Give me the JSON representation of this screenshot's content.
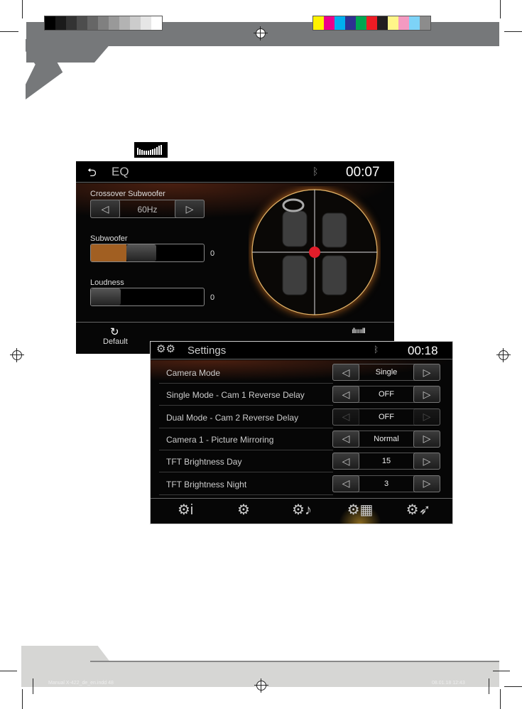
{
  "print_marks": {
    "gray_swatches": [
      "#000000",
      "#1a1a1a",
      "#333333",
      "#4d4d4d",
      "#666666",
      "#808080",
      "#999999",
      "#b3b3b3",
      "#cccccc",
      "#e6e6e6",
      "#ffffff"
    ],
    "color_swatches": [
      "#fff200",
      "#ec008c",
      "#00aeef",
      "#2e3192",
      "#00a651",
      "#ed1c24",
      "#231f20",
      "#fff689",
      "#f49ac1",
      "#7dd3f7",
      "#8c8c8c"
    ]
  },
  "eq_screen": {
    "title": "EQ",
    "time": "00:07",
    "crossover_label": "Crossover Subwoofer",
    "crossover_value": "60Hz",
    "subwoofer_label": "Subwoofer",
    "subwoofer_value": "0",
    "subwoofer_level_percent": 25,
    "loudness_label": "Loudness",
    "loudness_value": "0",
    "loudness_level_percent": 0,
    "default_label": "Default",
    "accent": "#b8651d",
    "balance_dot_color": "#e11d2a"
  },
  "settings_screen": {
    "title": "Settings",
    "time": "00:18",
    "rows": [
      {
        "label": "Camera Mode",
        "value": "Single",
        "enabled": true
      },
      {
        "label": "Single Mode - Cam 1 Reverse Delay",
        "value": "OFF",
        "enabled": true
      },
      {
        "label": "Dual Mode - Cam 2 Reverse Delay",
        "value": "OFF",
        "enabled": false
      },
      {
        "label": "Camera 1 - Picture Mirroring",
        "value": "Normal",
        "enabled": true
      },
      {
        "label": "TFT Brightness Day",
        "value": "15",
        "enabled": true
      },
      {
        "label": "TFT Brightness Night",
        "value": "3",
        "enabled": true
      }
    ],
    "bottom_tabs": [
      "info-gear-icon",
      "gear-icon",
      "music-gear-icon",
      "film-gear-icon",
      "compass-gear-icon"
    ],
    "active_tab": "film-gear-icon"
  },
  "footer": {
    "file": "Manual X-422_de_en.indd   48",
    "date": "08.01.18   12:43"
  }
}
